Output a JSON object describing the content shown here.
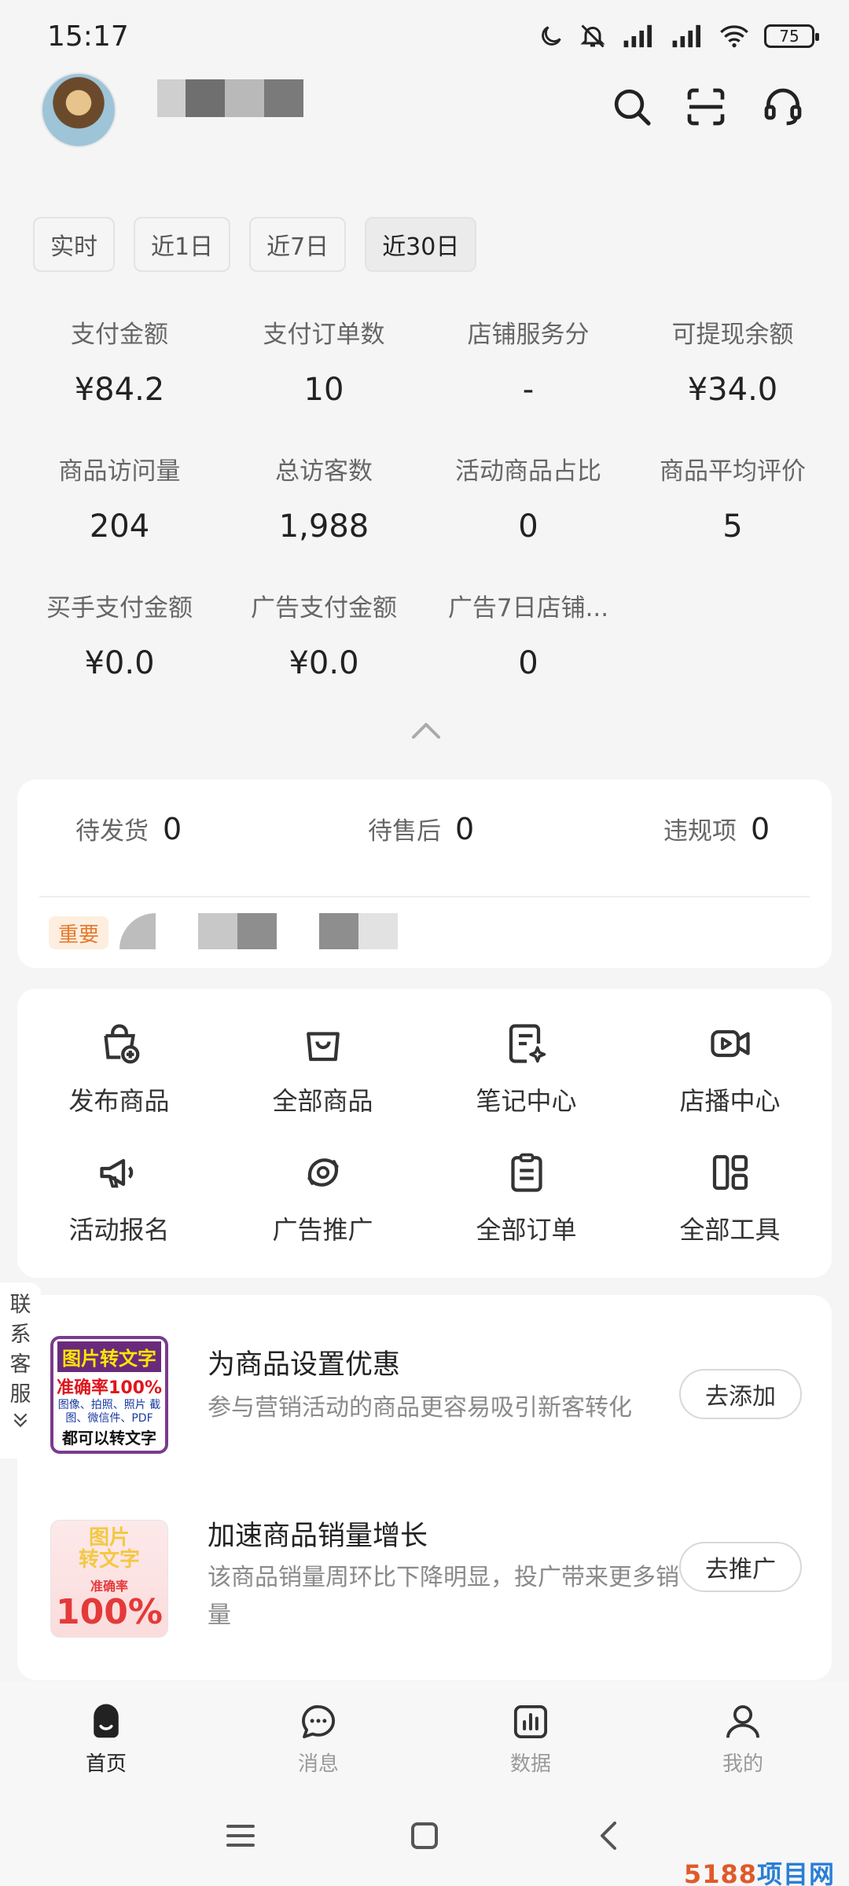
{
  "status_bar": {
    "time": "15:17",
    "battery": "75"
  },
  "header": {
    "shop_name": ""
  },
  "period_tabs": [
    {
      "label": "实时",
      "active": false
    },
    {
      "label": "近1日",
      "active": false
    },
    {
      "label": "近7日",
      "active": false
    },
    {
      "label": "近30日",
      "active": true
    }
  ],
  "metrics": [
    {
      "label": "支付金额",
      "value": "¥84.2"
    },
    {
      "label": "支付订单数",
      "value": "10"
    },
    {
      "label": "店铺服务分",
      "value": "-"
    },
    {
      "label": "可提现余额",
      "value": "¥34.0"
    },
    {
      "label": "商品访问量",
      "value": "204"
    },
    {
      "label": "总访客数",
      "value": "1,988"
    },
    {
      "label": "活动商品占比",
      "value": "0"
    },
    {
      "label": "商品平均评价",
      "value": "5"
    },
    {
      "label": "买手支付金额",
      "value": "¥0.0"
    },
    {
      "label": "广告支付金额",
      "value": "¥0.0"
    },
    {
      "label": "广告7日店铺...",
      "value": "0"
    }
  ],
  "pending": [
    {
      "label": "待发货",
      "value": "0"
    },
    {
      "label": "待售后",
      "value": "0"
    },
    {
      "label": "违规项",
      "value": "0"
    }
  ],
  "important_tag": "重要",
  "tools": [
    {
      "label": "发布商品",
      "icon": "publish-product-icon"
    },
    {
      "label": "全部商品",
      "icon": "bag-icon"
    },
    {
      "label": "笔记中心",
      "icon": "note-icon"
    },
    {
      "label": "店播中心",
      "icon": "video-icon"
    },
    {
      "label": "活动报名",
      "icon": "megaphone-icon"
    },
    {
      "label": "广告推广",
      "icon": "promotion-icon"
    },
    {
      "label": "全部订单",
      "icon": "clipboard-icon"
    },
    {
      "label": "全部工具",
      "icon": "grid-icon"
    }
  ],
  "side_contact": {
    "chars": [
      "联",
      "系",
      "客",
      "服"
    ]
  },
  "suggestions": [
    {
      "title": "为商品设置优惠",
      "desc": "参与营销活动的商品更容易吸引新客转化",
      "button": "去添加",
      "thumb": {
        "a": "图片转文字",
        "b": "准确率100%",
        "c": "图像、拍照、照片 截图、微信件、PDF",
        "d": "都可以转文字"
      }
    },
    {
      "title": "加速商品销量增长",
      "desc": "该商品销量周环比下降明显，投广带来更多销量",
      "button": "去推广",
      "thumb": {
        "a": "图片",
        "a2": "转文字",
        "b": "准确率",
        "c": "100%"
      }
    }
  ],
  "bottom_nav": [
    {
      "label": "首页",
      "active": true
    },
    {
      "label": "消息",
      "active": false
    },
    {
      "label": "数据",
      "active": false
    },
    {
      "label": "我的",
      "active": false
    }
  ],
  "watermark": {
    "num": "5188",
    "text": "项目网"
  },
  "colors": {
    "accent_tag_bg": "#fdeee0",
    "accent_tag_text": "#e67a2e",
    "background": "#f5f5f5",
    "card": "#ffffff"
  }
}
